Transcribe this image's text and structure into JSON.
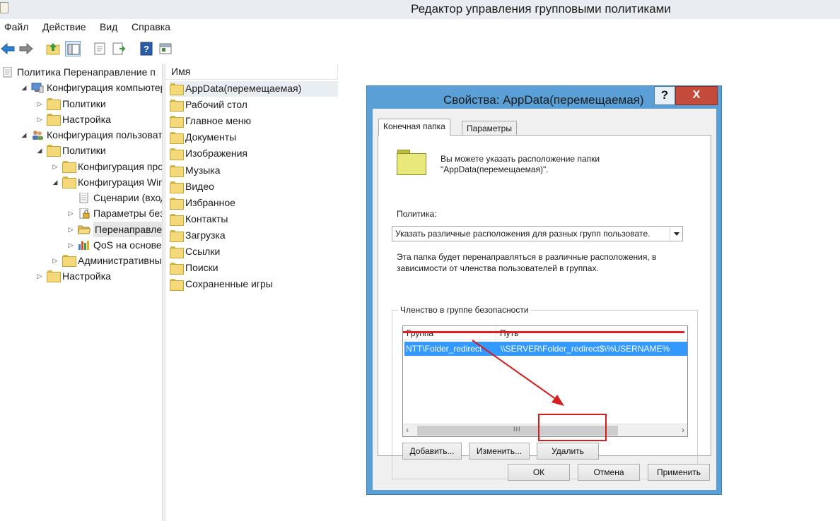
{
  "window": {
    "title": "Редактор управления групповыми политиками"
  },
  "menu": [
    "Файл",
    "Действие",
    "Вид",
    "Справка"
  ],
  "toolbar": [
    "back-icon",
    "forward-icon",
    "up-folder-icon",
    "show-hide-tree-icon",
    "properties-icon",
    "export-list-icon",
    "help-icon",
    "view-icon"
  ],
  "tree": [
    {
      "label": "Политика Перенаправление п",
      "depth": 0,
      "expander": "",
      "icon": "policy-icon"
    },
    {
      "label": "Конфигурация компьютер",
      "depth": 1,
      "expander": "open",
      "icon": "computer-icon"
    },
    {
      "label": "Политики",
      "depth": 2,
      "expander": "closed",
      "icon": "folder-icon"
    },
    {
      "label": "Настройка",
      "depth": 2,
      "expander": "closed",
      "icon": "folder-icon"
    },
    {
      "label": "Конфигурация пользовате",
      "depth": 1,
      "expander": "open",
      "icon": "users-icon"
    },
    {
      "label": "Политики",
      "depth": 2,
      "expander": "open",
      "icon": "folder-icon"
    },
    {
      "label": "Конфигурация прог",
      "depth": 3,
      "expander": "closed",
      "icon": "folder-icon"
    },
    {
      "label": "Конфигурация Wind",
      "depth": 3,
      "expander": "open",
      "icon": "folder-icon"
    },
    {
      "label": "Сценарии (вход/",
      "depth": 4,
      "expander": "",
      "icon": "script-icon"
    },
    {
      "label": "Параметры безо",
      "depth": 4,
      "expander": "closed",
      "icon": "security-icon"
    },
    {
      "label": "Перенаправлени",
      "depth": 4,
      "expander": "closed",
      "icon": "folder-open-icon",
      "selected": true
    },
    {
      "label": "QoS на основе п",
      "depth": 4,
      "expander": "closed",
      "icon": "chart-icon"
    },
    {
      "label": "Административные",
      "depth": 3,
      "expander": "closed",
      "icon": "folder-icon"
    },
    {
      "label": "Настройка",
      "depth": 2,
      "expander": "closed",
      "icon": "folder-icon"
    }
  ],
  "list": {
    "column": "Имя",
    "items": [
      "AppData(перемещаемая)",
      "Рабочий стол",
      "Главное меню",
      "Документы",
      "Изображения",
      "Музыка",
      "Видео",
      "Избранное",
      "Контакты",
      "Загрузка",
      "Ссылки",
      "Поиски",
      "Сохраненные игры"
    ]
  },
  "dialog": {
    "title": "Свойства: AppData(перемещаемая)",
    "help": "?",
    "close": "X",
    "tabs": [
      "Конечная папка",
      "Параметры"
    ],
    "intro_line1": "Вы можете указать расположение папки",
    "intro_line2": "\"AppData(перемещаемая)\".",
    "policy_label": "Политика:",
    "policy_value": "Указать различные расположения для разных групп пользоватe.",
    "desc_line1": "Эта папка будет перенаправляться в различные расположения, в",
    "desc_line2": "зависимости от членства пользователей в группах.",
    "group_legend": "Членство в группе безопасности",
    "columns": [
      "Группа",
      "Путь"
    ],
    "row": {
      "group": "NTT\\Folder_redirect",
      "path": "\\\\SERVER\\Folder_redirect$\\%USERNAME%"
    },
    "scroll_grip": "III",
    "buttons": {
      "add": "Добавить...",
      "edit": "Изменить...",
      "delete": "Удалить"
    },
    "footer": {
      "ok": "ОК",
      "cancel": "Отмена",
      "apply": "Применить"
    }
  },
  "colors": {
    "selection": "#3399ff",
    "annotation": "#d61c1c",
    "dialog_frame": "#5aa0d6"
  }
}
